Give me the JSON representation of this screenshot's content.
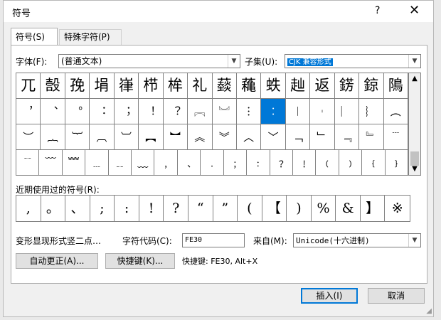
{
  "window": {
    "title": "符号",
    "help": "?",
    "close": "✕"
  },
  "tabs": [
    {
      "label": "符号(S)"
    },
    {
      "label": "特殊字符(P)"
    }
  ],
  "font": {
    "label": "字体(F):",
    "value": "(普通文本)"
  },
  "subset": {
    "label": "子集(U):",
    "value": "CJK 兼容形式"
  },
  "symbols": [
    [
      "兀",
      "嗀",
      "㝃",
      "埍",
      "嵂",
      "栉",
      "桙",
      "礼",
      "䕭",
      "蘒",
      "蛈",
      "赸",
      "返",
      "錺",
      "鍄",
      "隝"
    ],
    [
      "︐",
      "︑",
      "︒",
      "︓",
      "︔",
      "︕",
      "︖",
      "︗",
      "︘",
      "︙",
      "︰",
      "︱",
      "︲",
      "︳",
      "︴",
      "︵"
    ],
    [
      "︶",
      "︷",
      "︸",
      "︹",
      "︺",
      "︻",
      "︼",
      "︽",
      "︾",
      "︿",
      "﹀",
      "﹁",
      "﹂",
      "﹃",
      "﹄",
      "﹉"
    ],
    [
      "﹊",
      "﹋",
      "﹌",
      "﹍",
      "﹎",
      "﹏",
      "﹐",
      "﹑",
      "﹒",
      "﹔",
      "﹕",
      "﹖",
      "﹗",
      "﹙",
      "﹚",
      "﹛",
      "﹜"
    ]
  ],
  "recent": {
    "label": "近期使用过的符号(R):",
    "items": [
      ",",
      "。",
      "、",
      ";",
      ":",
      "!",
      "?",
      "“",
      "”",
      "(",
      "【",
      ")",
      "%",
      "&",
      "】",
      "※"
    ]
  },
  "char_name": "变形显现形式竖二点…",
  "char_code": {
    "label": "字符代码(C):",
    "value": "FE30"
  },
  "from": {
    "label": "来自(M):",
    "value": "Unicode(十六进制)"
  },
  "buttons": {
    "autocorrect": "自动更正(A)...",
    "shortcut_key": "快捷键(K)...",
    "shortcut_text": "快捷键: FE30, Alt+X",
    "insert": "插入(I)",
    "cancel": "取消"
  }
}
